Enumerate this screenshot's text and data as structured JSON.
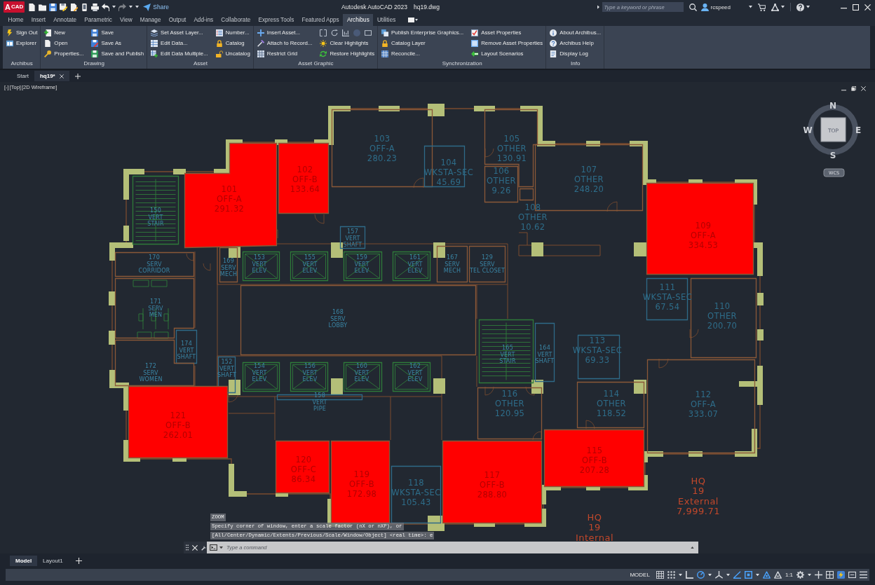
{
  "title_bar": {
    "logo": {
      "letter": "A",
      "label": "CAD"
    },
    "redo_disabled": true,
    "share": "Share",
    "title": "Autodesk AutoCAD 2023",
    "file": "hq19.dwg",
    "search": {
      "placeholder": "Type a keyword or phrase"
    },
    "user": "rcspeed"
  },
  "tabs": [
    {
      "label": "Home",
      "selected": false
    },
    {
      "label": "Insert",
      "selected": false
    },
    {
      "label": "Annotate",
      "selected": false
    },
    {
      "label": "Parametric",
      "selected": false
    },
    {
      "label": "View",
      "selected": false
    },
    {
      "label": "Manage",
      "selected": false
    },
    {
      "label": "Output",
      "selected": false
    },
    {
      "label": "Add-ins",
      "selected": false
    },
    {
      "label": "Collaborate",
      "selected": false
    },
    {
      "label": "Express Tools",
      "selected": false
    },
    {
      "label": "Featured Apps",
      "selected": false
    },
    {
      "label": "Archibus",
      "selected": true
    },
    {
      "label": "Utilities",
      "selected": false
    }
  ],
  "ribbon": [
    {
      "title": "Archibus",
      "columns": [
        [
          "Sign Out",
          "Explorer"
        ]
      ]
    },
    {
      "title": "Drawing",
      "columns": [
        [
          "New",
          "Open",
          "Properties..."
        ],
        [
          "Save",
          "Save As",
          "Save and Publish"
        ]
      ]
    },
    {
      "title": "Asset",
      "columns": [
        [
          "Set Asset Layer...",
          "Edit Data...",
          "Edit Data Multiple..."
        ],
        [
          "Number...",
          "Catalog",
          "Uncatalog"
        ]
      ]
    },
    {
      "title": "Asset Graphic",
      "tool_row": true,
      "columns": [
        [
          "Insert Asset...",
          "Attach to Record...",
          "Restrict Grid"
        ],
        [
          "Clear Highlights",
          "Restore Highlights"
        ]
      ]
    },
    {
      "title": "Synchronization",
      "columns": [
        [
          "Publish Enterprise Graphics...",
          "Catalog Layer",
          "Reconcile..."
        ],
        [
          "Asset Properties",
          "Remove Asset Properties",
          "Layout Scenarios"
        ]
      ]
    },
    {
      "title": "Info",
      "columns": [
        [
          "About Archibus...",
          "Archibus Help",
          "Display Log"
        ]
      ]
    }
  ],
  "file_tabs": [
    {
      "label": "Start",
      "selected": false
    },
    {
      "label": "hq19*",
      "selected": true
    }
  ],
  "viewport": {
    "controls": "[-]",
    "view": "[Top]",
    "style": "[2D Wireframe]"
  },
  "view_cube": {
    "north": "N",
    "east": "E",
    "south": "S",
    "west": "W",
    "face": "TOP",
    "ucs": "WCS"
  },
  "plan": {
    "rooms": [
      {
        "lines": [
          "103",
          "OFF-A",
          "280.23"
        ],
        "kind": "office",
        "highlighted": false
      },
      {
        "lines": [
          "105",
          "OTHER",
          "130.91"
        ],
        "kind": "office",
        "highlighted": false
      },
      {
        "lines": [
          "102",
          "OFF-B",
          "133.64"
        ],
        "kind": "office",
        "highlighted": true
      },
      {
        "lines": [
          "104",
          "WKSTA-SEC",
          "45.69"
        ],
        "kind": "workstation",
        "highlighted": false
      },
      {
        "lines": [
          "106",
          "OTHER",
          "9.26"
        ],
        "kind": "office",
        "highlighted": false
      },
      {
        "lines": [
          "107",
          "OTHER",
          "248.20"
        ],
        "kind": "office",
        "highlighted": false
      },
      {
        "lines": [
          "101",
          "OFF-A",
          "291.32"
        ],
        "kind": "office",
        "highlighted": true
      },
      {
        "lines": [
          "150",
          "VERT",
          "STAIR"
        ],
        "kind": "stair",
        "highlighted": false
      },
      {
        "lines": [
          "108",
          "OTHER",
          "10.62"
        ],
        "kind": "office",
        "highlighted": false
      },
      {
        "lines": [
          "157",
          "VERT",
          "SHAFT"
        ],
        "kind": "shaft",
        "highlighted": false
      },
      {
        "lines": [
          "109",
          "OFF-A",
          "334.53"
        ],
        "kind": "office",
        "highlighted": true
      },
      {
        "lines": [
          "170",
          "SERV",
          "CORRIDOR"
        ],
        "kind": "service",
        "highlighted": false
      },
      {
        "lines": [
          "169",
          "SERV",
          "MECH"
        ],
        "kind": "service",
        "highlighted": false
      },
      {
        "lines": [
          "153",
          "VERT",
          "ELEV"
        ],
        "kind": "elevator",
        "highlighted": false
      },
      {
        "lines": [
          "155",
          "VERT",
          "ELEV"
        ],
        "kind": "elevator",
        "highlighted": false
      },
      {
        "lines": [
          "159",
          "VERT",
          "ELEV"
        ],
        "kind": "elevator",
        "highlighted": false
      },
      {
        "lines": [
          "161",
          "VERT",
          "ELEV"
        ],
        "kind": "elevator",
        "highlighted": false
      },
      {
        "lines": [
          "167",
          "SERV",
          "MECH"
        ],
        "kind": "service",
        "highlighted": false
      },
      {
        "lines": [
          "129",
          "SERV",
          "TEL CLOSET"
        ],
        "kind": "service",
        "highlighted": false
      },
      {
        "lines": [
          "171",
          "SERV",
          "MEN"
        ],
        "kind": "service",
        "highlighted": false
      },
      {
        "lines": [
          "111",
          "WKSTA-SEC",
          "67.54"
        ],
        "kind": "workstation",
        "highlighted": false
      },
      {
        "lines": [
          "168",
          "SERV",
          "LOBBY"
        ],
        "kind": "service",
        "highlighted": false
      },
      {
        "lines": [
          "110",
          "OTHER",
          "200.70"
        ],
        "kind": "office",
        "highlighted": false
      },
      {
        "lines": [
          "174",
          "VERT",
          "SHAFT"
        ],
        "kind": "shaft",
        "highlighted": false
      },
      {
        "lines": [
          "165",
          "VERT",
          "STAIR"
        ],
        "kind": "stair",
        "highlighted": false
      },
      {
        "lines": [
          "164",
          "VERT",
          "SHAFT"
        ],
        "kind": "shaft",
        "highlighted": false
      },
      {
        "lines": [
          "113",
          "WKSTA-SEC",
          "69.33"
        ],
        "kind": "workstation",
        "highlighted": false
      },
      {
        "lines": [
          "172",
          "SERV",
          "WOMEN"
        ],
        "kind": "service",
        "highlighted": false
      },
      {
        "lines": [
          "152",
          "VERT",
          "SHAFT"
        ],
        "kind": "shaft",
        "highlighted": false
      },
      {
        "lines": [
          "154",
          "VERT",
          "ELEV"
        ],
        "kind": "elevator",
        "highlighted": false
      },
      {
        "lines": [
          "156",
          "VERT",
          "ELEV"
        ],
        "kind": "elevator",
        "highlighted": false
      },
      {
        "lines": [
          "160",
          "VERT",
          "ELEV"
        ],
        "kind": "elevator",
        "highlighted": false
      },
      {
        "lines": [
          "162",
          "VERT",
          "ELEV"
        ],
        "kind": "elevator",
        "highlighted": false
      },
      {
        "lines": [
          "158",
          "VERT",
          "PIPE"
        ],
        "kind": "shaft",
        "highlighted": false
      },
      {
        "lines": [
          "116",
          "OTHER",
          "120.95"
        ],
        "kind": "office",
        "highlighted": false
      },
      {
        "lines": [
          "114",
          "OTHER",
          "118.52"
        ],
        "kind": "office",
        "highlighted": false
      },
      {
        "lines": [
          "112",
          "OFF-A",
          "333.07"
        ],
        "kind": "office",
        "highlighted": false
      },
      {
        "lines": [
          "121",
          "OFF-B",
          "262.01"
        ],
        "kind": "office",
        "highlighted": true
      },
      {
        "lines": [
          "120",
          "OFF-C",
          "86.34"
        ],
        "kind": "office",
        "highlighted": true
      },
      {
        "lines": [
          "115",
          "OFF-B",
          "207.28"
        ],
        "kind": "office",
        "highlighted": true
      },
      {
        "lines": [
          "119",
          "OFF-B",
          "172.98"
        ],
        "kind": "office",
        "highlighted": true
      },
      {
        "lines": [
          "118",
          "WKSTA-SEC",
          "105.43"
        ],
        "kind": "workstation",
        "highlighted": false
      },
      {
        "lines": [
          "117",
          "OFF-B",
          "288.80"
        ],
        "kind": "office",
        "highlighted": true
      }
    ],
    "totals": [
      {
        "lines": [
          "HQ",
          "19",
          "External",
          "7,999.71"
        ]
      },
      {
        "lines": [
          "HQ",
          "19",
          "Internal"
        ]
      }
    ]
  },
  "command_line": {
    "history": [
      "ZOOM",
      "Specify corner of window, enter a scale factor (nX or nXP), or",
      "[All/Center/Dynamic/Extents/Previous/Scale/Window/Object] <real time>: e"
    ],
    "placeholder": "Type a command"
  },
  "layout_tabs": [
    {
      "label": "Model",
      "selected": true
    },
    {
      "label": "Layout1",
      "selected": false
    }
  ],
  "status_bar": {
    "space": "MODEL",
    "toggles": [
      {
        "kind": "grid",
        "on": false
      },
      {
        "kind": "snap",
        "on": false
      },
      {
        "kind": "ortho",
        "on": false
      },
      {
        "kind": "polar",
        "on": true
      },
      {
        "kind": "isodraft",
        "on": false
      },
      {
        "kind": "otrack",
        "on": true
      },
      {
        "kind": "osnap",
        "on": true
      },
      {
        "kind": "annotation",
        "on": true
      },
      {
        "kind": "autoscale",
        "on": false
      }
    ],
    "scale": "1:1"
  }
}
